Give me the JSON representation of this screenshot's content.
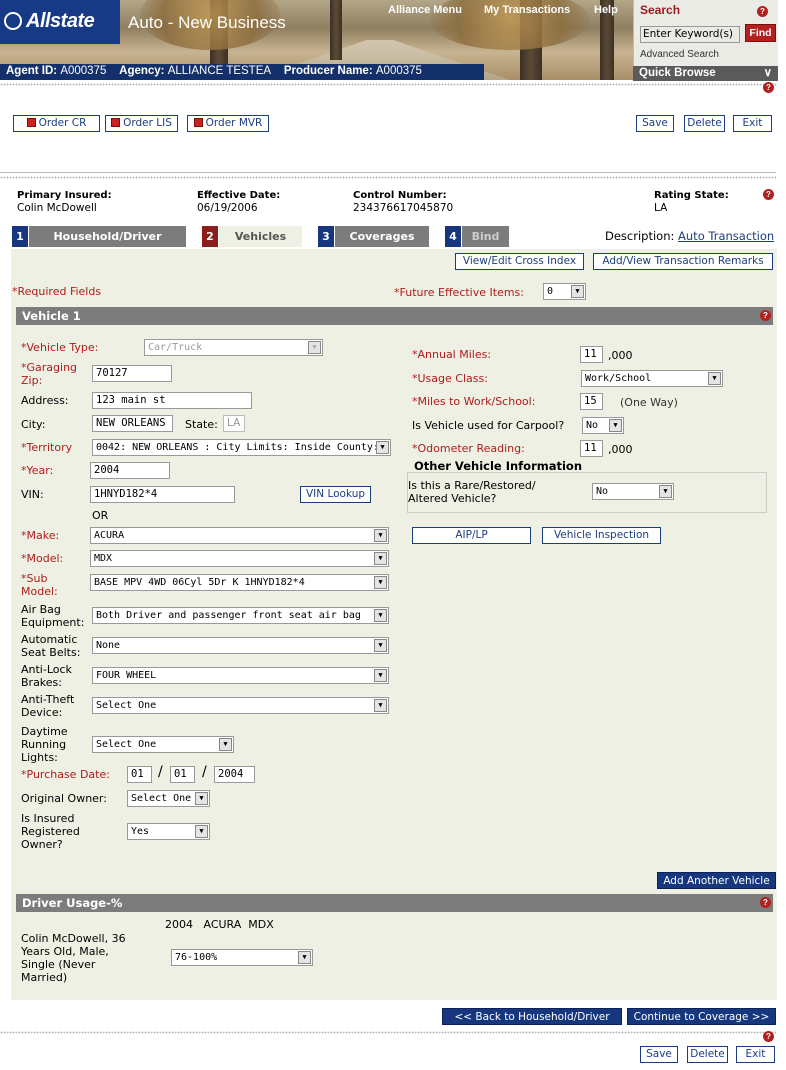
{
  "header": {
    "brand": "Allstate",
    "app_title": "Auto - New Business",
    "nav": [
      "Alliance Menu",
      "My Transactions",
      "Help"
    ],
    "agent_id_label": "Agent ID:",
    "agent_id": "A000375",
    "agency_label": "Agency:",
    "agency": "ALLIANCE TESTEA",
    "producer_label": "Producer Name:",
    "producer": "A000375"
  },
  "search": {
    "title": "Search",
    "input_value": "Enter Keyword(s)",
    "find_label": "Find",
    "advanced_label": "Advanced Search",
    "quick_browse_label": "Quick Browse"
  },
  "toolbar": {
    "order_cr": "Order CR",
    "order_lis": "Order LIS",
    "order_mvr": "Order MVR",
    "save": "Save",
    "delete": "Delete",
    "exit": "Exit"
  },
  "insured": {
    "primary_label": "Primary Insured:",
    "primary_value": "Colin  McDowell",
    "effective_label": "Effective Date:",
    "effective_value": "06/19/2006",
    "control_label": "Control Number:",
    "control_value": "234376617045870",
    "rating_label": "Rating State:",
    "rating_value": "LA"
  },
  "tabs": [
    {
      "num": "1",
      "label": "Household/Driver"
    },
    {
      "num": "2",
      "label": "Vehicles"
    },
    {
      "num": "3",
      "label": "Coverages"
    },
    {
      "num": "4",
      "label": "Bind"
    }
  ],
  "description": {
    "label": "Description:",
    "link": "Auto Transaction"
  },
  "actions": {
    "cross_index": "View/Edit Cross Index",
    "remarks": "Add/View Transaction Remarks"
  },
  "required_note": "*Required Fields",
  "future": {
    "label": "*Future Effective Items:",
    "value": "0"
  },
  "vehicle_section": "Vehicle 1",
  "vehicle": {
    "type_label": "*Vehicle Type:",
    "type_value": "Car/Truck",
    "zip_label": "*Garaging Zip:",
    "zip_value": "70127",
    "address_label": "Address:",
    "address_value": "123 main st",
    "city_label": "City:",
    "city_value": "NEW ORLEANS",
    "state_label": "State:",
    "state_value": "LA",
    "territory_label": "*Territory",
    "territory_value": "0042: NEW ORLEANS : City Limits: Inside County:",
    "year_label": "*Year:",
    "year_value": "2004",
    "vin_label": "VIN:",
    "vin_value": "1HNYD182*4",
    "vin_lookup": "VIN Lookup",
    "or_text": "OR",
    "make_label": "*Make:",
    "make_value": "ACURA",
    "model_label": "*Model:",
    "model_value": "MDX",
    "submodel_label": "*Sub Model:",
    "submodel_value": "BASE MPV 4WD 06Cyl 5Dr K 1HNYD182*4",
    "airbag_label": "Air Bag Equipment:",
    "airbag_value": "Both Driver and passenger front seat air bag",
    "seatbelt_label": "Automatic Seat Belts:",
    "seatbelt_value": "None",
    "antilock_label": "Anti-Lock Brakes:",
    "antilock_value": "FOUR WHEEL",
    "antitheft_label": "Anti-Theft Device:",
    "antitheft_value": "Select One",
    "drl_label": "Daytime Running Lights:",
    "drl_value": "Select One",
    "purchase_label": "*Purchase Date:",
    "purchase_month": "01",
    "purchase_day": "01",
    "purchase_year": "2004",
    "date_sep": "/",
    "owner_label": "Original Owner:",
    "owner_value": "Select One",
    "registered_label": "Is Insured Registered Owner?",
    "registered_value": "Yes"
  },
  "usage": {
    "annual_label": "*Annual Miles:",
    "annual_value": "11",
    "annual_suffix": ",000",
    "class_label": "*Usage Class:",
    "class_value": "Work/School",
    "miles_label": "*Miles to Work/School:",
    "miles_value": "15",
    "miles_suffix": "(One Way)",
    "carpool_label": "Is Vehicle used for Carpool?",
    "carpool_value": "No",
    "odometer_label": "*Odometer Reading:",
    "odometer_value": "11",
    "odometer_suffix": ",000",
    "other_title": "Other Vehicle Information",
    "rare_label": "Is this a Rare/Restored/ Altered Vehicle?",
    "rare_value": "No",
    "aip_button": "AIP/LP",
    "inspection_button": "Vehicle Inspection"
  },
  "add_vehicle": "Add Another Vehicle",
  "driver_usage": {
    "title": "Driver Usage-%",
    "vehicle_heading": "2004   ACURA  MDX",
    "driver_desc": "Colin  McDowell, 36 Years Old, Male, Single (Never Married)",
    "value": "76-100%"
  },
  "nav_buttons": {
    "back": "<< Back to Household/Driver",
    "next": "Continue to Coverage >>"
  },
  "bottom_toolbar": {
    "save": "Save",
    "delete": "Delete",
    "exit": "Exit"
  },
  "colors": {
    "navy": "#16377e",
    "required_red": "#b01b1b",
    "form_bg": "#eef0e4",
    "section_grey": "#7c7c7c"
  }
}
